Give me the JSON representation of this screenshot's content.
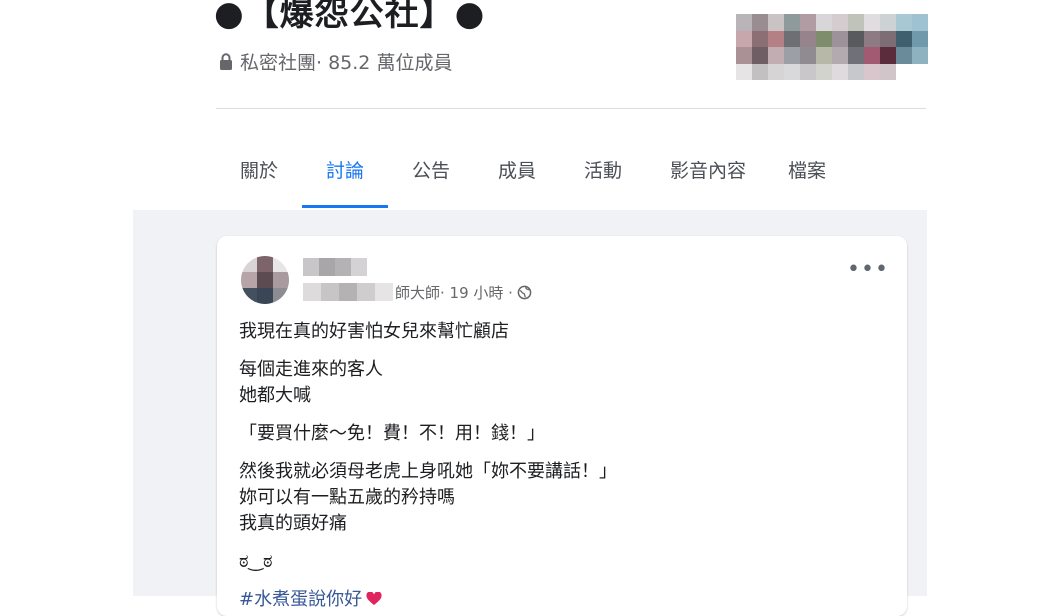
{
  "group": {
    "title": "●【爆怨公社】●",
    "privacy": "私密社團",
    "members": "· 85.2 萬位成員"
  },
  "tabs": [
    {
      "label": "關於"
    },
    {
      "label": "討論",
      "active": true
    },
    {
      "label": "公告"
    },
    {
      "label": "成員"
    },
    {
      "label": "活動"
    },
    {
      "label": "影音內容"
    },
    {
      "label": "檔案"
    }
  ],
  "post": {
    "author_suffix": "師大師",
    "time": " · 19 小時 · ",
    "more_label": "•••",
    "lines": [
      "我現在真的好害怕女兒來幫忙顧店",
      "每個走進來的客人",
      "她都大喊",
      "「要買什麼～免！費！不！用！錢！」",
      "然後我就必須母老虎上身吼她「妳不要講話！」",
      "妳可以有一點五歲的矜持嗎",
      "我真的頭好痛",
      "ಠ‿ಠ",
      "#水煮蛋說你好"
    ]
  },
  "colors": {
    "accent": "#1877f2",
    "feed_background": "#f0f2f5",
    "hashtag": "#385898",
    "heart": "#e0245e"
  },
  "icons": {
    "privacy": "lock-icon",
    "audience": "globe-icon",
    "reaction": "heart-icon"
  }
}
